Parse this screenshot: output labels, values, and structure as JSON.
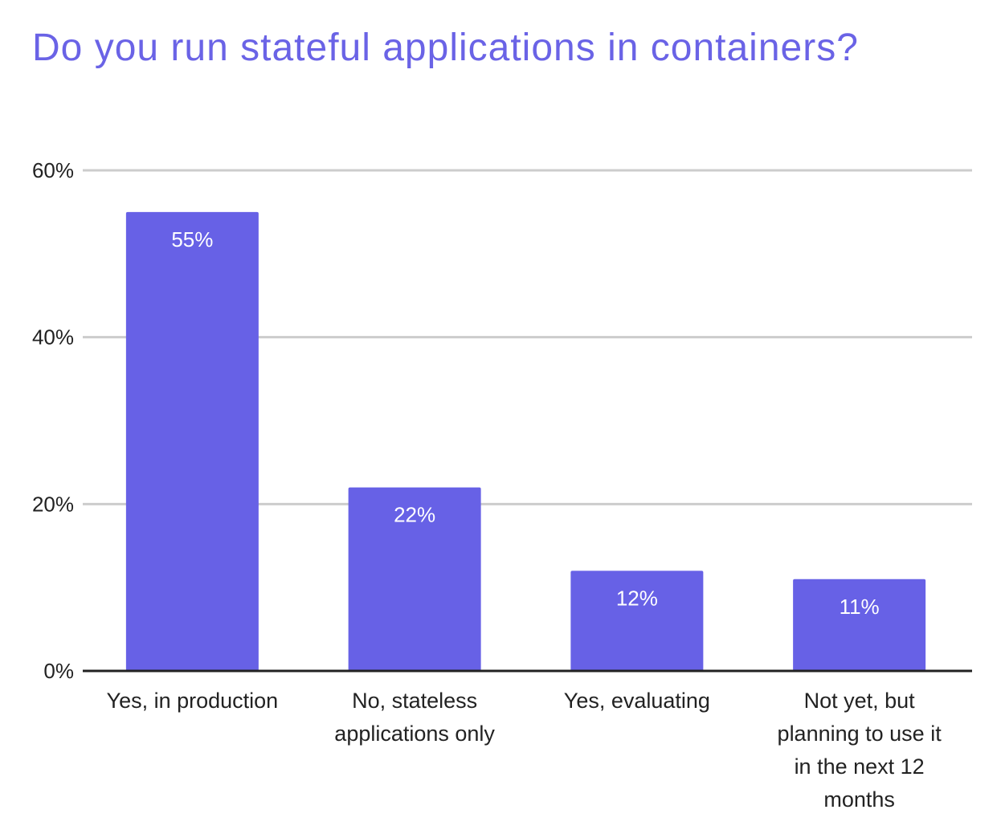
{
  "colors": {
    "title": "#6A63E6",
    "bar": "#6761E6",
    "grid": "#cccccc",
    "axis": "#222222"
  },
  "chart_data": {
    "type": "bar",
    "title": "Do you run stateful applications in containers?",
    "xlabel": "",
    "ylabel": "",
    "ylim": [
      0,
      60
    ],
    "yticks": [
      0,
      20,
      40,
      60
    ],
    "ytick_labels": [
      "0%",
      "20%",
      "40%",
      "60%"
    ],
    "grid": true,
    "legend": "none",
    "categories": [
      "Yes, in production",
      "No, stateless applications only",
      "Yes, evaluating",
      "Not yet, but planning to use it in the next 12 months"
    ],
    "category_lines": [
      [
        "Yes, in production"
      ],
      [
        "No, stateless",
        "applications only"
      ],
      [
        "Yes, evaluating"
      ],
      [
        "Not yet, but",
        "planning to use it",
        "in the next 12",
        "months"
      ]
    ],
    "values": [
      55,
      22,
      12,
      11
    ],
    "value_labels": [
      "55%",
      "22%",
      "12%",
      "11%"
    ]
  }
}
